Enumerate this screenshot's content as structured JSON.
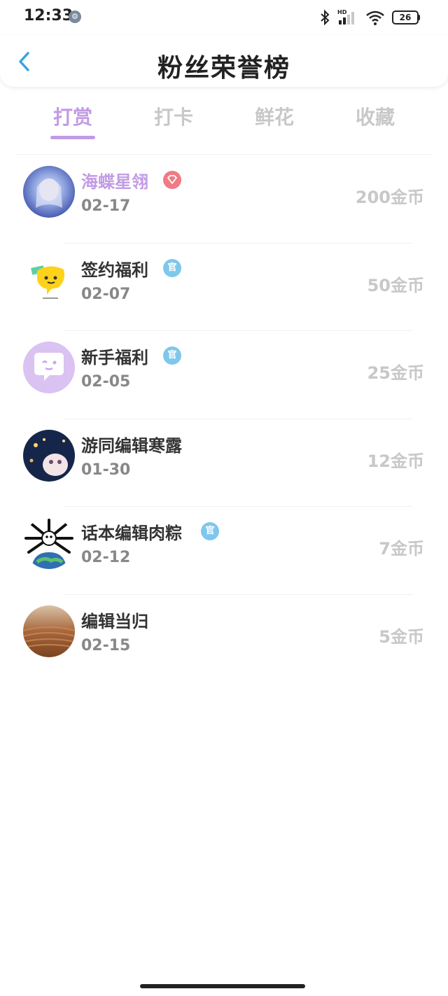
{
  "status": {
    "time": "12:33",
    "network_label": "HD",
    "battery": "26",
    "icons": [
      "settings-icon",
      "bluetooth-icon",
      "signal-icon",
      "wifi-icon",
      "battery-icon"
    ]
  },
  "header": {
    "title": "粉丝荣誉榜",
    "back_icon": "chevron-left-icon"
  },
  "tabs": [
    {
      "label": "打赏",
      "active": true
    },
    {
      "label": "打卡",
      "active": false
    },
    {
      "label": "鲜花",
      "active": false
    },
    {
      "label": "收藏",
      "active": false
    }
  ],
  "fans": [
    {
      "name": "海蝶星翎",
      "date": "02-17",
      "coins": "200金币",
      "badge": "gem-icon",
      "highlight": true
    },
    {
      "name": "签约福利",
      "date": "02-07",
      "coins": "50金币",
      "badge": "官"
    },
    {
      "name": "新手福利",
      "date": "02-05",
      "coins": "25金币",
      "badge": "官"
    },
    {
      "name": "游同编辑寒露",
      "date": "01-30",
      "coins": "12金币",
      "badge": ""
    },
    {
      "name": "话本编辑肉粽",
      "date": "02-12",
      "coins": "7金币",
      "badge": "官"
    },
    {
      "name": "编辑当归",
      "date": "02-15",
      "coins": "5金币",
      "badge": ""
    }
  ],
  "colors": {
    "accent": "#c19be5",
    "muted": "#c8c8c8",
    "gem_badge": "#f07a86",
    "official_badge": "#7fc7ec"
  }
}
